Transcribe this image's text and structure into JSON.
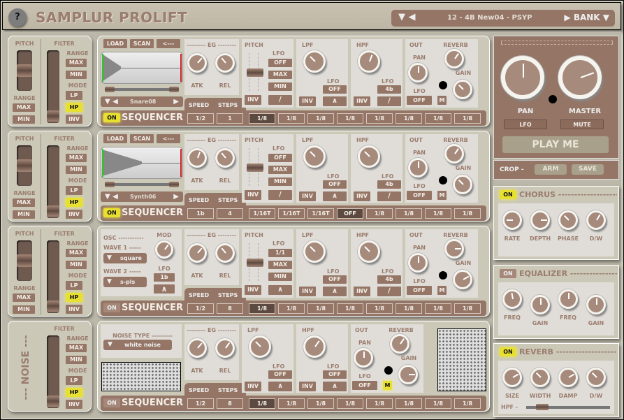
{
  "app": {
    "title": "SAMPLUR PROLIFT",
    "help_label": "?"
  },
  "bank": {
    "prev_symbols": "▼ ◀",
    "preset": "12 - 4B New04 - PSYP",
    "next_symbol": "▶",
    "bank_label": "BANK ▼"
  },
  "common": {
    "pitch": "PITCH",
    "filter": "FILTER",
    "range": "RANGE",
    "mode": "MODE",
    "max": "MAX",
    "min": "MIN",
    "lp": "LP",
    "hp": "HP",
    "inv": "INV",
    "load": "LOAD",
    "scan": "SCAN",
    "back": "<---",
    "eg": "-------- EG --------",
    "atk": "ATK",
    "rel": "REL",
    "lfo": "LFO",
    "lpf": "LPF",
    "hpf": "HPF",
    "out": "OUT",
    "reverb": "REVERB",
    "pan": "PAN",
    "gain": "GAIN",
    "m": "M",
    "off": "OFF",
    "speed": "SPEED",
    "steps": "STEPS",
    "sequencer": "SEQUENCER",
    "on": "ON",
    "ramp_symbol": "∕",
    "peak_symbol": "∧",
    "noise_side": "--- NOISE ---"
  },
  "rows": [
    {
      "sample": "Snare08",
      "seq_on": true,
      "speed": "1/2",
      "steps": "1",
      "pitch_lfo": "OFF",
      "lpf_lfo": "OFF",
      "hpf_lfo": "4b",
      "out_lfo": "OFF",
      "seq": [
        "1/8",
        "1/8",
        "1/8",
        "1/8",
        "1/8",
        "1/8",
        "1/8",
        "1/8"
      ],
      "active_step": 0
    },
    {
      "sample": "Synth06",
      "seq_on": true,
      "speed": "1b",
      "steps": "4",
      "pitch_lfo": "OFF",
      "lpf_lfo": "OFF",
      "hpf_lfo": "4b",
      "out_lfo": "OFF",
      "seq": [
        "1/16T",
        "1/16T",
        "1/16T",
        "OFF",
        "1/8",
        "1/8",
        "1/8",
        "1/8"
      ],
      "active_step": 3
    },
    {
      "osc": "OSC -----------",
      "mod": "MOD",
      "wave1_label": "WAVE 1 -----",
      "wave1": "square",
      "wave2_label": "WAVE 2 -----",
      "wave2": "s-pls",
      "osc_lfo": "1b",
      "seq_on": false,
      "speed": "1/2",
      "steps": "8",
      "pitch_lfo": "1/1",
      "lpf_lfo": "OFF",
      "hpf_lfo": "4b",
      "out_lfo": "OFF",
      "seq": [
        "1/8",
        "1/8",
        "1/8",
        "1/8",
        "1/8",
        "1/8",
        "1/8",
        "1/8"
      ],
      "active_step": 0
    },
    {
      "noise_type_label": "NOISE TYPE ---------",
      "noise_type": "white noise",
      "seq_on": false,
      "speed": "1/2",
      "steps": "8",
      "lpf_lfo": "OFF",
      "hpf_lfo": "OFF",
      "out_lfo": "OFF",
      "seq": [
        "1/8",
        "1/8",
        "1/8",
        "1/8",
        "1/8",
        "1/8",
        "1/8",
        "1/8"
      ],
      "active_step": 0
    }
  ],
  "master": {
    "pan": "PAN",
    "master": "MASTER",
    "lfo": "LFO",
    "mute": "MUTE",
    "play": "PLAY ME",
    "crop": "CROP -",
    "arm": "ARM",
    "save": "SAVE"
  },
  "chorus": {
    "title": "CHORUS -----------------------",
    "on": "ON",
    "knobs": [
      "RATE",
      "DEPTH",
      "PHASE",
      "D/W"
    ]
  },
  "equalizer": {
    "title": "EQUALIZER -----------------",
    "on": "ON",
    "knobs": [
      "FREQ",
      "GAIN",
      "FREQ",
      "GAIN"
    ]
  },
  "reverb": {
    "title": "REVERB -----------------------",
    "on": "ON",
    "knobs": [
      "SIZE",
      "WIDTH",
      "DAMP",
      "D/W"
    ],
    "hpf": "HPF -"
  }
}
